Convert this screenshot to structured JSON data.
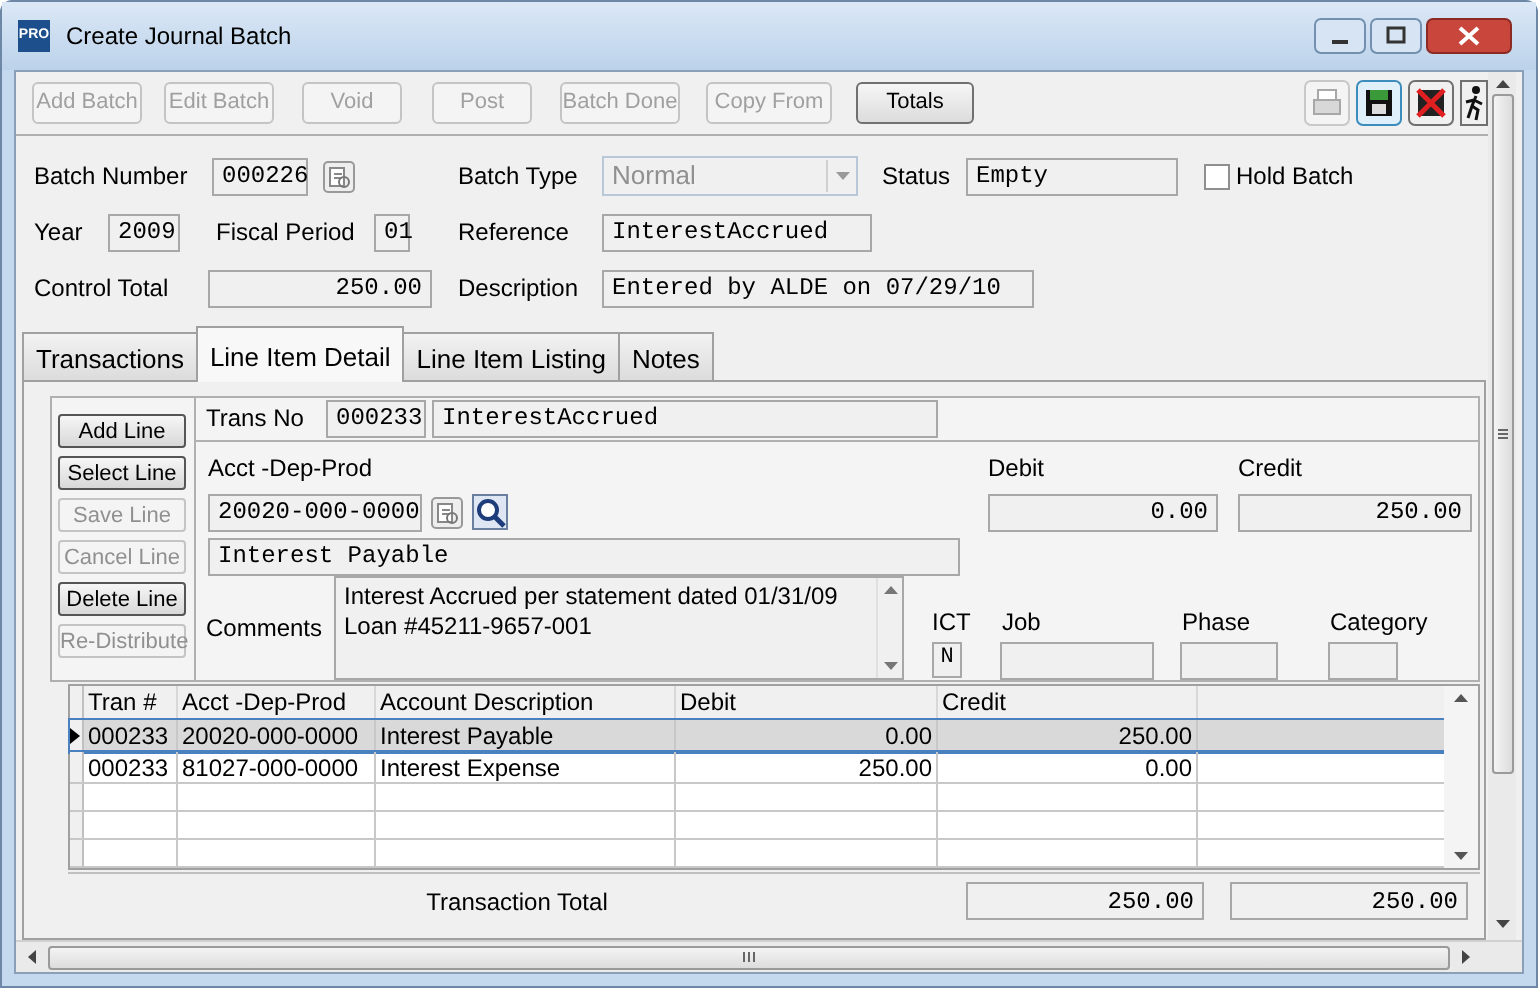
{
  "window": {
    "title": "Create Journal Batch",
    "app_badge": "PRO"
  },
  "toolbar": [
    {
      "label": "Add Batch",
      "disabled": true
    },
    {
      "label": "Edit Batch",
      "disabled": true
    },
    {
      "label": "Void",
      "disabled": true
    },
    {
      "label": "Post",
      "disabled": true
    },
    {
      "label": "Batch Done",
      "disabled": true
    },
    {
      "label": "Copy From",
      "disabled": true
    },
    {
      "label": "Totals",
      "disabled": false
    }
  ],
  "header": {
    "batch_number": {
      "label": "Batch Number",
      "value": "000226"
    },
    "batch_type": {
      "label": "Batch Type",
      "value": "Normal",
      "disabled": true
    },
    "status": {
      "label": "Status",
      "value": "Empty"
    },
    "hold_batch": {
      "label": "Hold Batch",
      "checked": false
    },
    "year": {
      "label": "Year",
      "value": "2009"
    },
    "fiscal_period": {
      "label": "Fiscal Period",
      "value": "01"
    },
    "reference": {
      "label": "Reference",
      "value": "InterestAccrued"
    },
    "control_total": {
      "label": "Control Total",
      "value": "250.00"
    },
    "description": {
      "label": "Description",
      "value": "Entered by ALDE on 07/29/10"
    }
  },
  "tabs": [
    {
      "label": "Transactions",
      "selected": false
    },
    {
      "label": "Line Item Detail",
      "selected": true
    },
    {
      "label": "Line Item Listing",
      "selected": false
    },
    {
      "label": "Notes",
      "selected": false
    }
  ],
  "line_buttons": [
    {
      "label": "Add Line",
      "disabled": false
    },
    {
      "label": "Select Line",
      "disabled": false
    },
    {
      "label": "Save Line",
      "disabled": true
    },
    {
      "label": "Cancel Line",
      "disabled": true
    },
    {
      "label": "Delete Line",
      "disabled": false
    },
    {
      "label": "Re-Distribute",
      "disabled": true
    }
  ],
  "detail": {
    "trans_no": {
      "label": "Trans No",
      "value": "000233",
      "description": "InterestAccrued"
    },
    "account": {
      "label": "Acct -Dep-Prod",
      "value": "20020-000-0000",
      "name": "Interest Payable"
    },
    "debit": {
      "label": "Debit",
      "value": "0.00"
    },
    "credit": {
      "label": "Credit",
      "value": "250.00"
    },
    "comments": {
      "label": "Comments",
      "value": "Interest Accrued per statement dated 01/31/09\nLoan #45211-9657-001"
    },
    "ict": {
      "label": "ICT",
      "value": "N"
    },
    "job": {
      "label": "Job"
    },
    "phase": {
      "label": "Phase"
    },
    "category": {
      "label": "Category"
    }
  },
  "grid": {
    "columns": [
      "Tran #",
      "Acct -Dep-Prod",
      "Account Description",
      "Debit",
      "Credit"
    ],
    "rows": [
      {
        "cells": [
          "000233",
          "20020-000-0000",
          "Interest Payable",
          "0.00",
          "250.00"
        ],
        "selected": true
      },
      {
        "cells": [
          "000233",
          "81027-000-0000",
          "Interest Expense",
          "250.00",
          "0.00"
        ],
        "selected": false
      }
    ]
  },
  "totals": {
    "label": "Transaction Total",
    "debit": "250.00",
    "credit": "250.00"
  }
}
